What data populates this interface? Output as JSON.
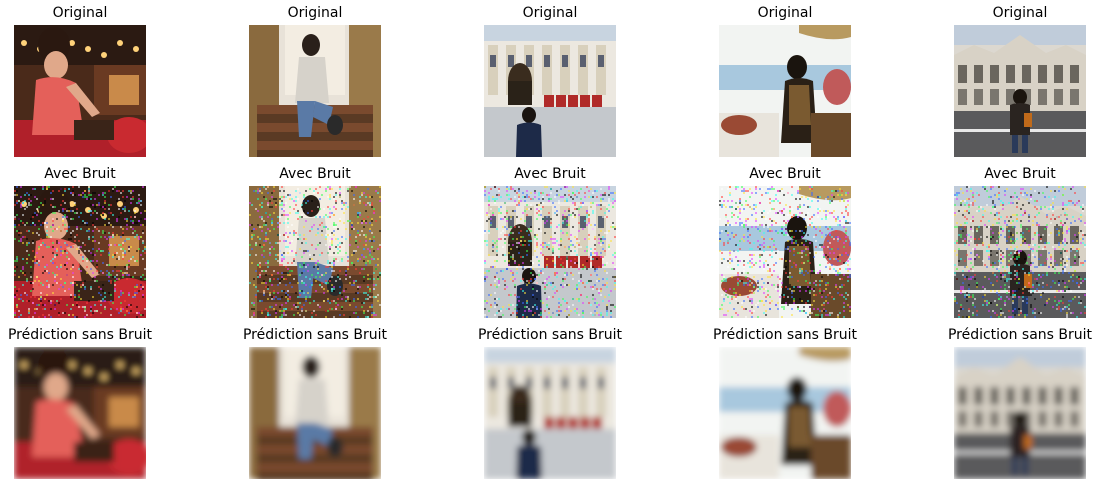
{
  "rows": [
    {
      "label": "Original",
      "variant": "clean"
    },
    {
      "label": "Avec Bruit",
      "variant": "noisy"
    },
    {
      "label": "Prédiction sans Bruit",
      "variant": "blurred"
    }
  ],
  "images": [
    {
      "scene": "restaurant",
      "palette": {
        "bg": "#4a2a1a",
        "accent": "#d93a3a",
        "light": "#e8b56a",
        "person": "#e4605a"
      }
    },
    {
      "scene": "staircase",
      "palette": {
        "bg": "#e8e2d8",
        "accent": "#6b4a2e",
        "light": "#f4efe6",
        "person": "#c9c4bc"
      }
    },
    {
      "scene": "palace",
      "palette": {
        "bg": "#ece8e0",
        "accent": "#8a7e6a",
        "light": "#b7c7d8",
        "person": "#1d2a48"
      }
    },
    {
      "scene": "terrace",
      "palette": {
        "bg": "#f2f4f2",
        "accent": "#7a5a3a",
        "light": "#bcd4e6",
        "person": "#2a2016"
      }
    },
    {
      "scene": "parliament",
      "palette": {
        "bg": "#dcd8d0",
        "accent": "#9a948a",
        "light": "#c8d4e2",
        "person": "#3a2c22"
      }
    }
  ]
}
